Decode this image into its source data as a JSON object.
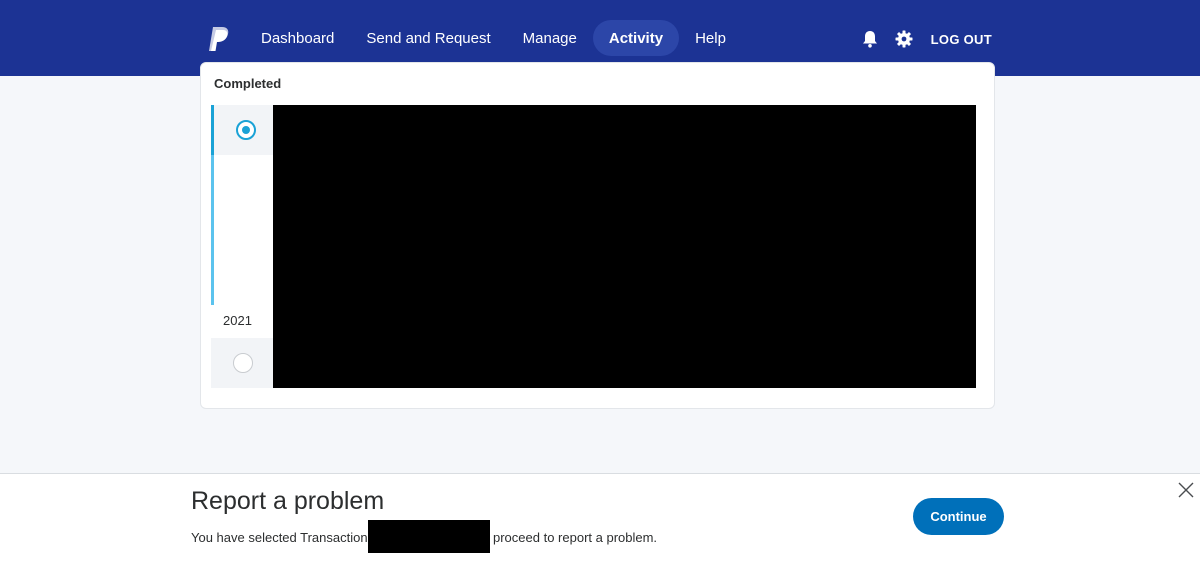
{
  "header": {
    "logo_icon": "paypal-logo-icon",
    "nav": [
      {
        "label": "Dashboard"
      },
      {
        "label": "Send and Request"
      },
      {
        "label": "Manage"
      },
      {
        "label": "Activity",
        "active": true
      },
      {
        "label": "Help"
      }
    ],
    "notifications_icon": "bell-icon",
    "settings_icon": "gear-icon",
    "logout_label": "LOG OUT"
  },
  "activity": {
    "status_label": "Completed",
    "year_label": "2021"
  },
  "report": {
    "title": "Report a problem",
    "text_before": "You have selected Transaction",
    "text_after": "proceed to report a problem.",
    "continue_label": "Continue",
    "close_icon": "close-icon"
  },
  "colors": {
    "header_bg": "#1c3394",
    "primary_button": "#0070ba",
    "timeline_accent": "#1aa2d6"
  }
}
